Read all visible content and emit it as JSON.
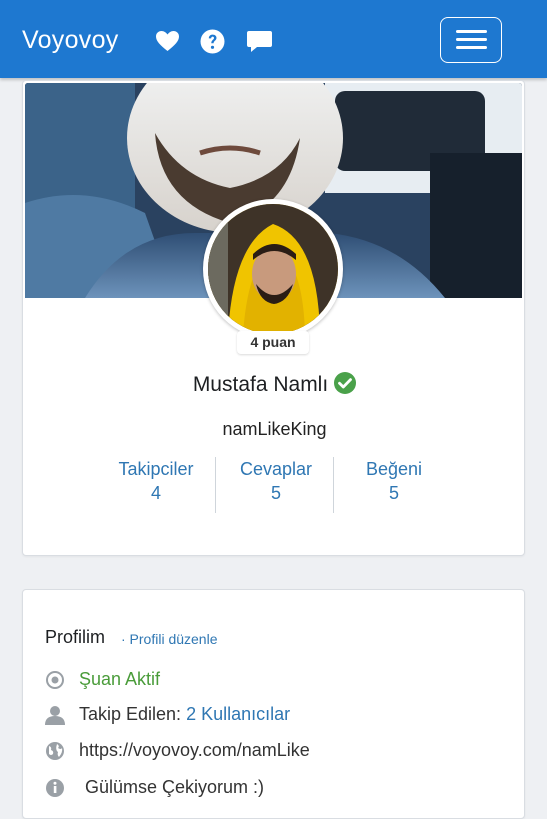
{
  "navbar": {
    "brand": "Voyovoy",
    "icons": [
      "heart-icon",
      "help-icon",
      "chat-icon"
    ],
    "menu_toggle": "menu-icon",
    "background_color": "#1e78d0"
  },
  "profile": {
    "points": "4 puan",
    "name": "Mustafa Namlı",
    "verified_color": "#4aa14a",
    "username": "namLikeKing",
    "stats": [
      {
        "label": "Takipciler",
        "value": "4"
      },
      {
        "label": "Cevaplar",
        "value": "5"
      },
      {
        "label": "Beğeni",
        "value": "5"
      }
    ]
  },
  "about": {
    "title": "Profilim",
    "edit_link": "· Profili düzenle",
    "status": "Şuan Aktif",
    "following_label": "Takip Edilen:",
    "following_value": "2 Kullanıcılar",
    "website": "https://voyovoy.com/namLike",
    "bio": "Gülümse Çekiyorum :)"
  }
}
